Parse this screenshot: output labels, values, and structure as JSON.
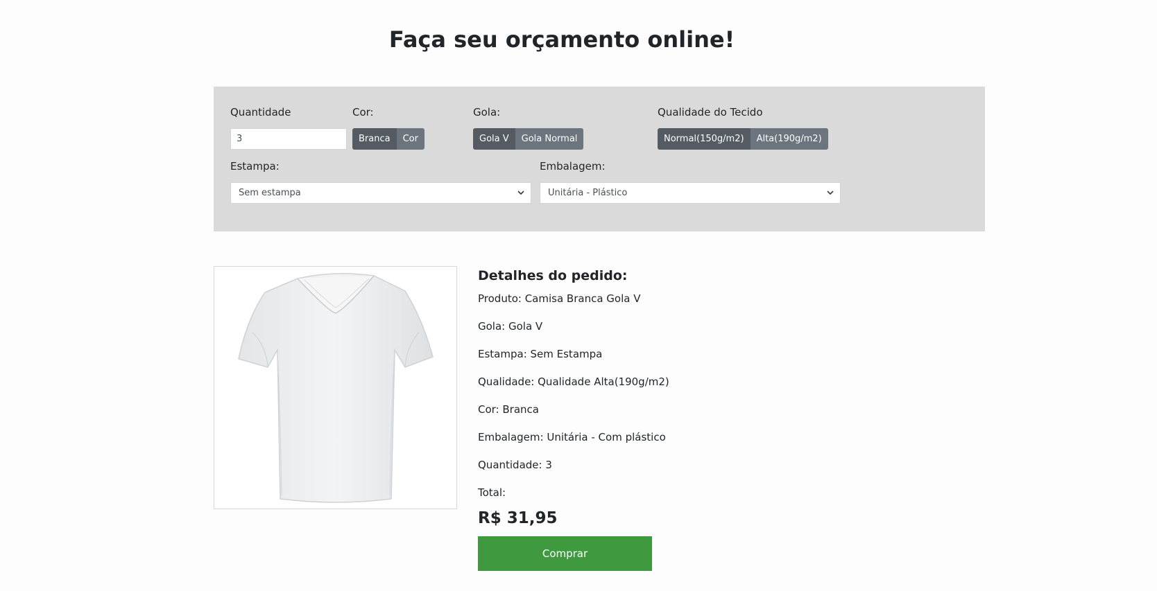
{
  "header": {
    "title": "Faça seu orçamento online!"
  },
  "options": {
    "quantity": {
      "label": "Quantidade",
      "value": "3"
    },
    "color": {
      "label": "Cor:",
      "options": [
        "Branca",
        "Cor"
      ],
      "selected": "Branca"
    },
    "collar": {
      "label": "Gola:",
      "options": [
        "Gola V",
        "Gola Normal"
      ],
      "selected": "Gola V"
    },
    "fabric": {
      "label": "Qualidade do Tecido",
      "options": [
        "Normal(150g/m2)",
        "Alta(190g/m2)"
      ],
      "selected": "Normal(150g/m2)"
    },
    "print": {
      "label": "Estampa:",
      "value": "Sem estampa"
    },
    "packaging": {
      "label": "Embalagem:",
      "value": "Unitária - Plástico"
    }
  },
  "details": {
    "title": "Detalhes do pedido:",
    "lines": [
      "Produto: Camisa Branca Gola V",
      "Gola: Gola V",
      "Estampa: Sem Estampa",
      "Qualidade: Qualidade Alta(190g/m2)",
      "Cor: Branca",
      "Embalagem: Unitária - Com plástico",
      "Quantidade: 3",
      "Total:"
    ],
    "total": "R$ 31,95",
    "buy_label": "Comprar"
  },
  "colors": {
    "panel": "#dadada",
    "button_active": "#545b62",
    "button": "#6c757d",
    "buy": "#3f9a3f"
  },
  "icons": {
    "select": "chevron-down-icon",
    "product": "tshirt-image"
  }
}
